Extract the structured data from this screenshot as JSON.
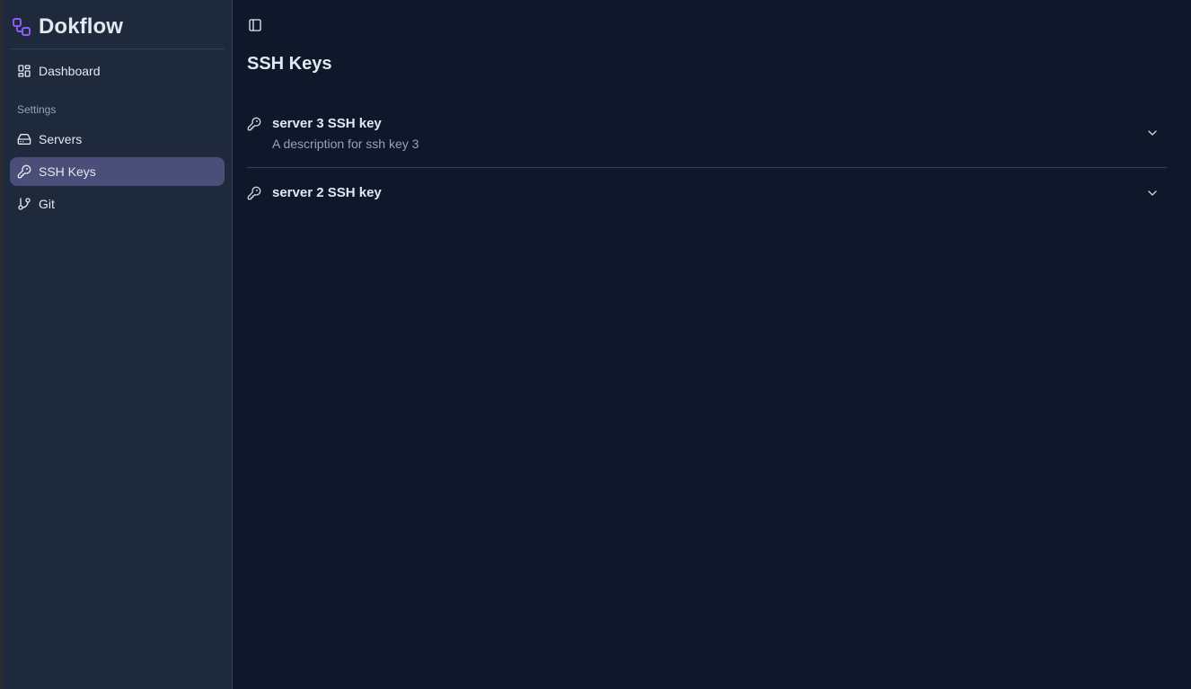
{
  "app": {
    "name": "Dokflow",
    "logo_icon": "workflow-icon",
    "accent": "#8b5cf6"
  },
  "sidebar": {
    "items": [
      {
        "label": "Dashboard",
        "icon": "dashboard-icon",
        "active": false
      },
      {
        "label": "Servers",
        "icon": "server-icon",
        "active": false
      },
      {
        "label": "SSH Keys",
        "icon": "key-icon",
        "active": true
      },
      {
        "label": "Git",
        "icon": "git-branch-icon",
        "active": false
      }
    ],
    "group_label": "Settings",
    "active_bg": "#4a4e78"
  },
  "header": {
    "toggle_icon": "sidebar-toggle-icon"
  },
  "main": {
    "title": "SSH Keys",
    "keys": [
      {
        "name": "server 3 SSH key",
        "description": "A description for ssh key 3",
        "icon": "key-icon",
        "expand_icon": "chevron-down-icon"
      },
      {
        "name": "server 2 SSH key",
        "description": "",
        "icon": "key-icon",
        "expand_icon": "chevron-down-icon"
      }
    ]
  }
}
